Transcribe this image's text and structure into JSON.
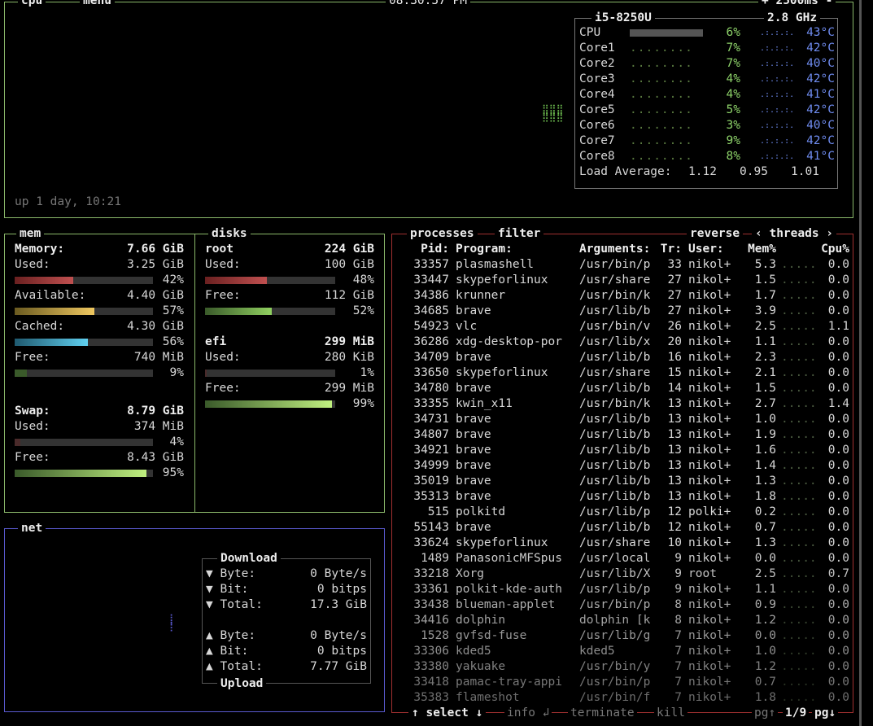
{
  "cpu": {
    "tag": "cpu",
    "menu_tag": "menu",
    "clock": "08:30:57 PM",
    "interval": "+ 2500ms -",
    "uptime": "up 1 day, 10:21",
    "model": "i5-8250U",
    "freq": "2.8 GHz",
    "rows": [
      {
        "name": "CPU",
        "pct": "6%",
        "temp": "43°C"
      },
      {
        "name": "Core1",
        "pct": "7%",
        "temp": "42°C"
      },
      {
        "name": "Core2",
        "pct": "7%",
        "temp": "40°C"
      },
      {
        "name": "Core3",
        "pct": "4%",
        "temp": "42°C"
      },
      {
        "name": "Core4",
        "pct": "4%",
        "temp": "41°C"
      },
      {
        "name": "Core5",
        "pct": "5%",
        "temp": "42°C"
      },
      {
        "name": "Core6",
        "pct": "3%",
        "temp": "40°C"
      },
      {
        "name": "Core7",
        "pct": "9%",
        "temp": "42°C"
      },
      {
        "name": "Core8",
        "pct": "8%",
        "temp": "41°C"
      }
    ],
    "load_label": "Load Average:",
    "load": [
      "1.12",
      "0.95",
      "1.01"
    ]
  },
  "mem": {
    "tag": "mem",
    "memory_label": "Memory:",
    "memory_val": "7.66 GiB",
    "used_label": "Used:",
    "used_val": "3.25 GiB",
    "used_pct": "42%",
    "avail_label": "Available:",
    "avail_val": "4.40 GiB",
    "avail_pct": "57%",
    "cached_label": "Cached:",
    "cached_val": "4.30 GiB",
    "cached_pct": "56%",
    "free_label": "Free:",
    "free_val": "740 MiB",
    "free_pct": "9%",
    "swap_label": "Swap:",
    "swap_val": "8.79 GiB",
    "swap_used_label": "Used:",
    "swap_used_val": "374 MiB",
    "swap_used_pct": "4%",
    "swap_free_label": "Free:",
    "swap_free_val": "8.43 GiB",
    "swap_free_pct": "95%"
  },
  "disks": {
    "tag": "disks",
    "root_label": "root",
    "root_val": "224 GiB",
    "root_used_label": "Used:",
    "root_used_val": "100 GiB",
    "root_used_pct": "48%",
    "root_free_label": "Free:",
    "root_free_val": "112 GiB",
    "root_free_pct": "52%",
    "efi_label": "efi",
    "efi_val": "299 MiB",
    "efi_used_label": "Used:",
    "efi_used_val": "280 KiB",
    "efi_used_pct": "1%",
    "efi_free_label": "Free:",
    "efi_free_val": "299 MiB",
    "efi_free_pct": "99%"
  },
  "net": {
    "tag": "net",
    "download_label": "Download",
    "upload_label": "Upload",
    "down": [
      {
        "label": "▼ Byte:",
        "value": "0 Byte/s"
      },
      {
        "label": "▼ Bit:",
        "value": "0 bitps"
      },
      {
        "label": "▼ Total:",
        "value": "17.3 GiB"
      }
    ],
    "up": [
      {
        "label": "▲ Byte:",
        "value": "0 Byte/s"
      },
      {
        "label": "▲ Bit:",
        "value": "0 bitps"
      },
      {
        "label": "▲ Total:",
        "value": "7.77 GiB"
      }
    ]
  },
  "proc": {
    "tag": "processes",
    "filter": "filter",
    "reverse": "reverse",
    "threads": "‹ threads ›",
    "headers": [
      "Pid:",
      "Program:",
      "Arguments:",
      "Tr:",
      "User:",
      "Mem%",
      "Cpu%"
    ],
    "rows": [
      [
        "33357",
        "plasmashell",
        "/usr/bin/p",
        "33",
        "nikol+",
        "5.3",
        "0.0"
      ],
      [
        "33447",
        "skypeforlinux",
        "/usr/share",
        "27",
        "nikol+",
        "1.5",
        "0.0"
      ],
      [
        "34386",
        "krunner",
        "/usr/bin/k",
        "27",
        "nikol+",
        "1.7",
        "0.0"
      ],
      [
        "34685",
        "brave",
        "/usr/lib/b",
        "27",
        "nikol+",
        "3.9",
        "0.0"
      ],
      [
        "54923",
        "vlc",
        "/usr/bin/v",
        "26",
        "nikol+",
        "2.5",
        "1.1"
      ],
      [
        "36286",
        "xdg-desktop-por",
        "/usr/lib/x",
        "20",
        "nikol+",
        "1.1",
        "0.0"
      ],
      [
        "34709",
        "brave",
        "/usr/lib/b",
        "16",
        "nikol+",
        "2.3",
        "0.0"
      ],
      [
        "33650",
        "skypeforlinux",
        "/usr/share",
        "15",
        "nikol+",
        "2.1",
        "0.0"
      ],
      [
        "34780",
        "brave",
        "/usr/lib/b",
        "14",
        "nikol+",
        "1.5",
        "0.0"
      ],
      [
        "33355",
        "kwin_x11",
        "/usr/bin/k",
        "13",
        "nikol+",
        "2.7",
        "1.4"
      ],
      [
        "34731",
        "brave",
        "/usr/lib/b",
        "13",
        "nikol+",
        "1.0",
        "0.0"
      ],
      [
        "34807",
        "brave",
        "/usr/lib/b",
        "13",
        "nikol+",
        "1.9",
        "0.0"
      ],
      [
        "34921",
        "brave",
        "/usr/lib/b",
        "13",
        "nikol+",
        "1.6",
        "0.0"
      ],
      [
        "34999",
        "brave",
        "/usr/lib/b",
        "13",
        "nikol+",
        "1.4",
        "0.0"
      ],
      [
        "35019",
        "brave",
        "/usr/lib/b",
        "13",
        "nikol+",
        "1.3",
        "0.0"
      ],
      [
        "35313",
        "brave",
        "/usr/lib/b",
        "13",
        "nikol+",
        "1.8",
        "0.0"
      ],
      [
        "515",
        "polkitd",
        "/usr/lib/p",
        "12",
        "polki+",
        "0.2",
        "0.0"
      ],
      [
        "55143",
        "brave",
        "/usr/lib/b",
        "12",
        "nikol+",
        "0.7",
        "0.0"
      ],
      [
        "33624",
        "skypeforlinux",
        "/usr/share",
        "10",
        "nikol+",
        "1.3",
        "0.0"
      ],
      [
        "1489",
        "PanasonicMFSpus",
        "/usr/local",
        "9",
        "nikol+",
        "0.0",
        "0.0"
      ],
      [
        "33218",
        "Xorg",
        "/usr/lib/X",
        "9",
        "root",
        "2.5",
        "0.7"
      ],
      [
        "33361",
        "polkit-kde-auth",
        "/usr/lib/p",
        "9",
        "nikol+",
        "1.1",
        "0.0"
      ],
      [
        "33438",
        "blueman-applet",
        "/usr/bin/p",
        "8",
        "nikol+",
        "0.9",
        "0.0"
      ],
      [
        "34416",
        "dolphin",
        "dolphin [k",
        "8",
        "nikol+",
        "1.2",
        "0.0"
      ],
      [
        "1528",
        "gvfsd-fuse",
        "/usr/lib/g",
        "7",
        "nikol+",
        "0.0",
        "0.0"
      ],
      [
        "33306",
        "kded5",
        "kded5",
        "7",
        "nikol+",
        "1.0",
        "0.0"
      ],
      [
        "33380",
        "yakuake",
        "/usr/bin/y",
        "7",
        "nikol+",
        "1.2",
        "0.0"
      ],
      [
        "33418",
        "pamac-tray-appi",
        "/usr/bin/p",
        "7",
        "nikol+",
        "0.7",
        "0.0"
      ],
      [
        "35383",
        "flameshot",
        "/usr/bin/f",
        "7",
        "nikol+",
        "1.8",
        "0.0"
      ]
    ],
    "footer": {
      "select": "↑ select ↓",
      "info": "info ↲",
      "terminate": "terminate",
      "kill": "kill",
      "pg_prev": "pg↑",
      "page": "1/9",
      "pg_next": "pg↓"
    }
  },
  "colors": {
    "cpu_border": "#8ab86a",
    "mem_border": "#8ab86a",
    "net_border": "#5a5ad0",
    "proc_border": "#a03030"
  }
}
